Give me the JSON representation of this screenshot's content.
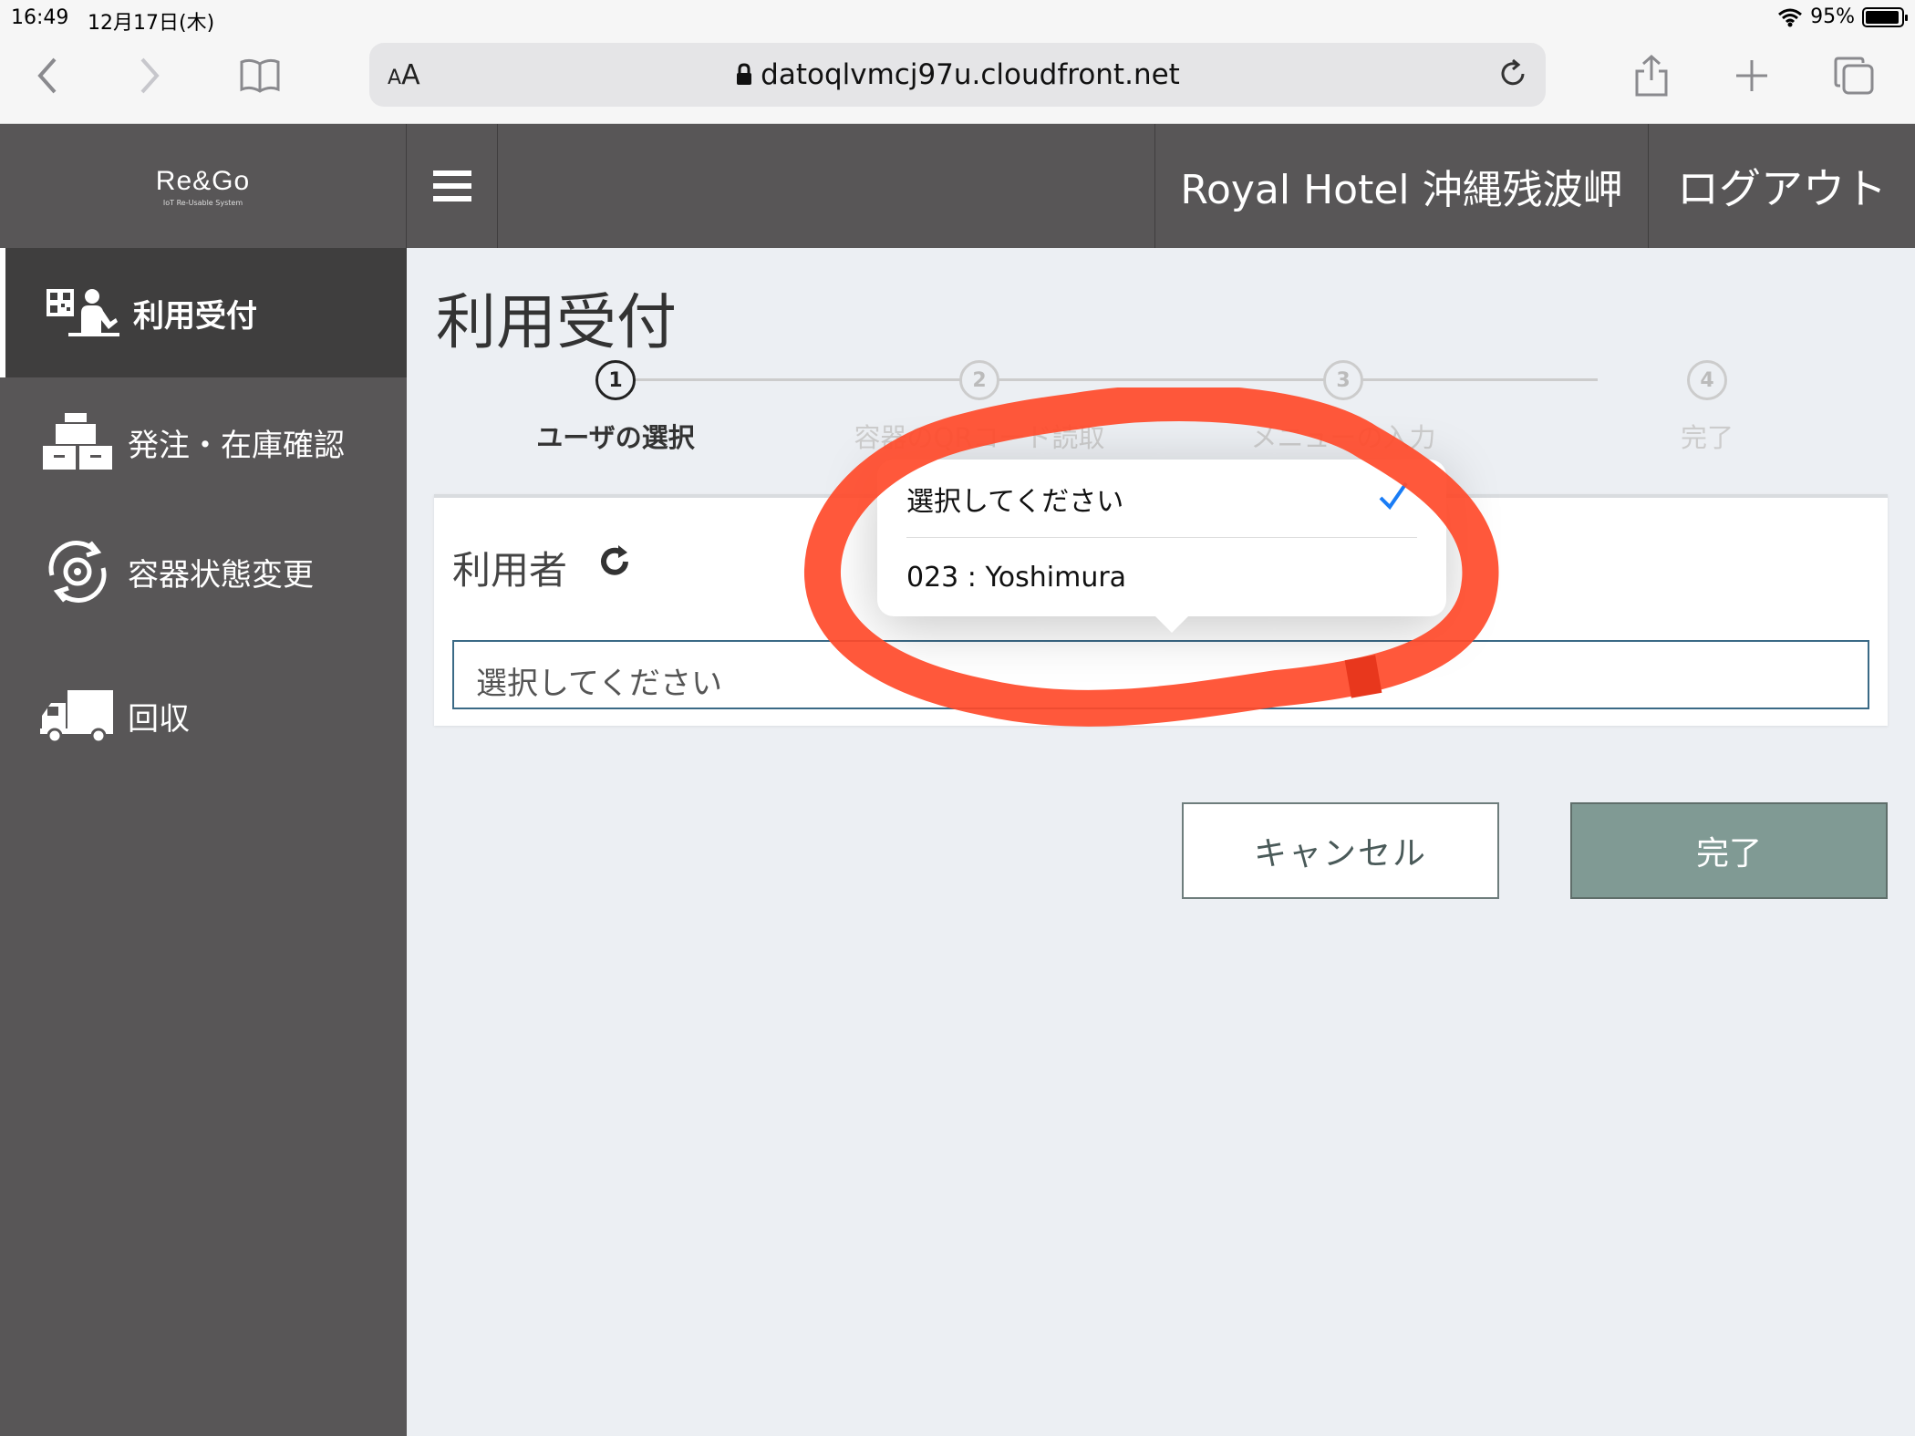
{
  "status_bar": {
    "time": "16:49",
    "date": "12月17日(木)",
    "battery_text": "95%",
    "battery_level": 0.95
  },
  "browser": {
    "aa_label_small": "A",
    "aa_label_big": "A",
    "url": "datoqlvmcj97u.cloudfront.net"
  },
  "header": {
    "logo": "Re&Go",
    "logo_sub": "IoT Re-Usable System",
    "hotel_name": "Royal Hotel 沖縄残波岬",
    "logout_label": "ログアウト"
  },
  "sidebar": {
    "items": [
      {
        "label": "利用受付",
        "icon": "qr-reception-icon",
        "active": true
      },
      {
        "label": "発注・在庫確認",
        "icon": "boxes-icon",
        "active": false
      },
      {
        "label": "容器状態変更",
        "icon": "gear-cycle-icon",
        "active": false
      },
      {
        "label": "回収",
        "icon": "truck-icon",
        "active": false
      }
    ]
  },
  "main": {
    "title": "利用受付",
    "steps": [
      {
        "number": "1",
        "label": "ユーザの選択",
        "active": true
      },
      {
        "number": "2",
        "label": "容器のQRコード読取",
        "active": false
      },
      {
        "number": "3",
        "label": "メニューの入力",
        "active": false
      },
      {
        "number": "4",
        "label": "完了",
        "active": false
      }
    ],
    "user_label": "利用者",
    "select_value": "選択してください",
    "cancel_label": "キャンセル",
    "done_label": "完了"
  },
  "dropdown": {
    "options": [
      {
        "label": "選択してください",
        "selected": true
      },
      {
        "label": "023 : Yoshimura",
        "selected": false
      }
    ]
  },
  "colors": {
    "header_bg": "#585657",
    "sidebar_active": "#3f3e3e",
    "done_button": "#809a94",
    "annotation": "#ff4a2a",
    "check": "#1a7cf5"
  }
}
